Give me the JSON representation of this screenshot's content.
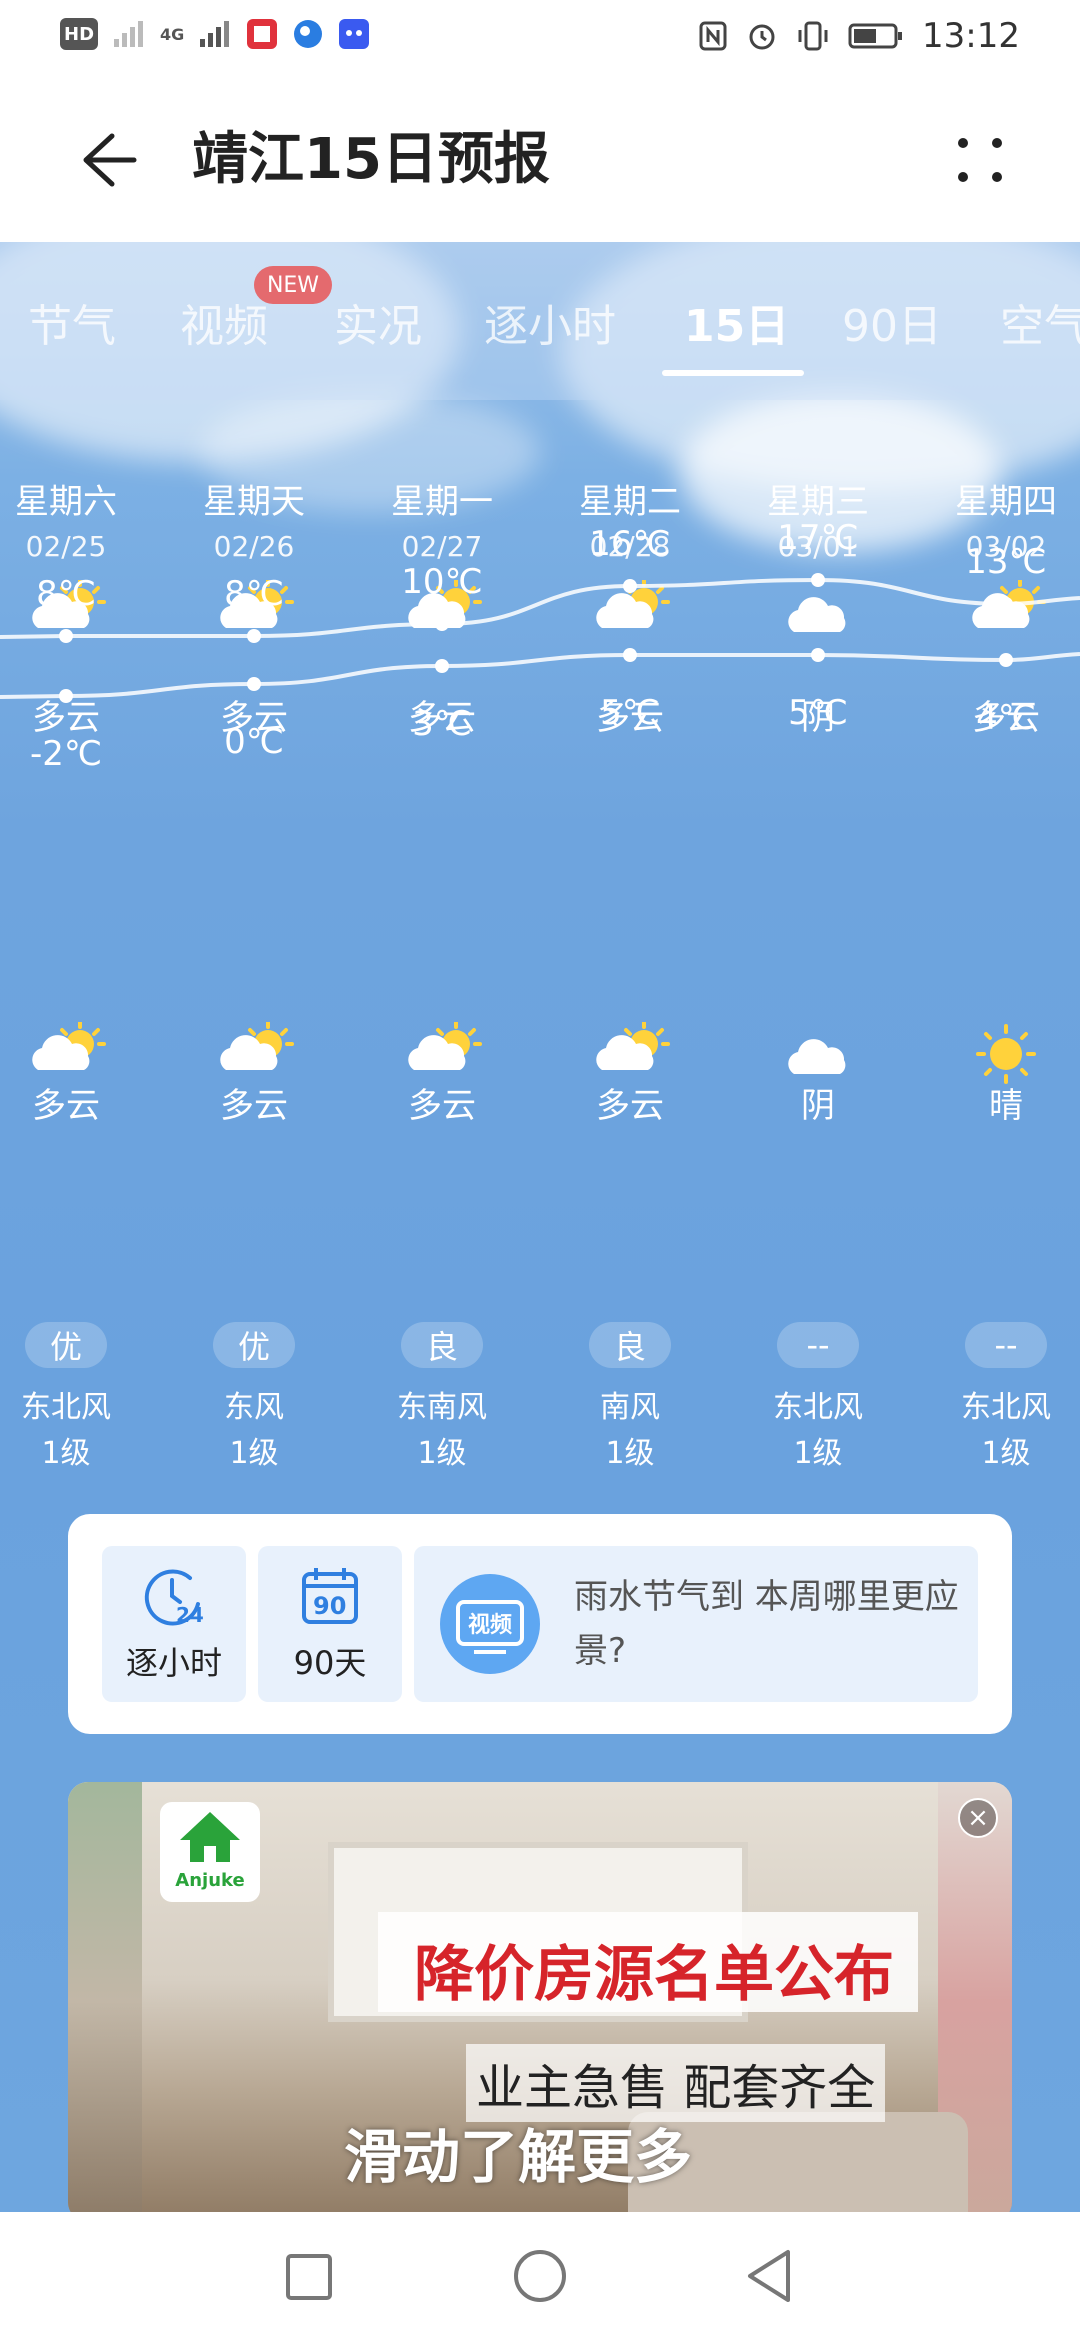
{
  "status_bar": {
    "network_hd": "HD",
    "network_4g": "4G",
    "time": "13:12"
  },
  "app_bar": {
    "title": "靖江15日预报"
  },
  "tabs": [
    {
      "label": "节气",
      "active": false
    },
    {
      "label": "视频",
      "active": false,
      "badge": "NEW"
    },
    {
      "label": "实况",
      "active": false
    },
    {
      "label": "逐小时",
      "active": false
    },
    {
      "label": "15日",
      "active": true
    },
    {
      "label": "90日",
      "active": false
    },
    {
      "label": "空气",
      "active": false
    }
  ],
  "days": [
    {
      "weekday": "星期六",
      "date": "02/25",
      "day_icon": "partly-cloudy-icon",
      "day_cond": "多云",
      "high": "8℃",
      "low": "-2℃",
      "night_icon": "partly-cloudy-icon",
      "night_cond": "多云",
      "aqi": "优",
      "wind": "东北风",
      "level": "1级"
    },
    {
      "weekday": "星期天",
      "date": "02/26",
      "day_icon": "partly-cloudy-icon",
      "day_cond": "多云",
      "high": "8℃",
      "low": "0℃",
      "night_icon": "partly-cloudy-icon",
      "night_cond": "多云",
      "aqi": "优",
      "wind": "东风",
      "level": "1级"
    },
    {
      "weekday": "星期一",
      "date": "02/27",
      "day_icon": "partly-cloudy-icon",
      "day_cond": "多云",
      "high": "10℃",
      "low": "3℃",
      "night_icon": "partly-cloudy-icon",
      "night_cond": "多云",
      "aqi": "良",
      "wind": "东南风",
      "level": "1级"
    },
    {
      "weekday": "星期二",
      "date": "02/28",
      "day_icon": "partly-cloudy-icon",
      "day_cond": "多云",
      "high": "16℃",
      "low": "5℃",
      "night_icon": "partly-cloudy-icon",
      "night_cond": "多云",
      "aqi": "良",
      "wind": "南风",
      "level": "1级"
    },
    {
      "weekday": "星期三",
      "date": "03/01",
      "day_icon": "cloud-icon",
      "day_cond": "阴",
      "high": "17℃",
      "low": "5℃",
      "night_icon": "cloud-icon",
      "night_cond": "阴",
      "aqi": "--",
      "wind": "东北风",
      "level": "1级"
    },
    {
      "weekday": "星期四",
      "date": "03/02",
      "day_icon": "partly-cloudy-icon",
      "day_cond": "多云",
      "high": "13℃",
      "low": "4℃",
      "night_icon": "sun-icon",
      "night_cond": "晴",
      "aqi": "--",
      "wind": "东北风",
      "level": "1级"
    }
  ],
  "temperature_curve": {
    "high_values": [
      8,
      8,
      10,
      16,
      17,
      13
    ],
    "low_values": [
      -2,
      0,
      3,
      5,
      5,
      4
    ]
  },
  "quick_card": {
    "hourly_label": "逐小时",
    "hourly_icon_text": "24",
    "days90_label": "90天",
    "days90_icon_text": "90",
    "video_icon_text": "视频",
    "video_text": "雨水节气到 本周哪里更应景?"
  },
  "ad": {
    "brand": "Anjuke",
    "headline": "降价房源名单公布",
    "subline": "业主急售 配套齐全",
    "cta": "滑动了解更多"
  },
  "colors": {
    "sky": "#6ea4de",
    "ad_headline": "#d6242a",
    "badge": "#e46a6e",
    "brand_green": "#2aa33a"
  }
}
